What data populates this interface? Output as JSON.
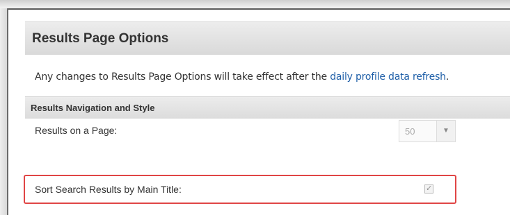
{
  "panel": {
    "title": "Results Page Options",
    "notice_prefix": "Any changes to Results Page Options will take effect after the ",
    "notice_link": "daily profile data refresh",
    "notice_suffix": "."
  },
  "section": {
    "title": "Results Navigation and Style"
  },
  "rows": {
    "results_per_page_label": "Results on a Page:",
    "results_per_page_value": "50",
    "sort_label": "Sort Search Results by Main Title:",
    "sort_checked": true
  },
  "icons": {
    "dropdown": "chevron-down-icon",
    "checkbox_mark": "check-icon"
  },
  "colors": {
    "link": "#1f5fa8",
    "highlight_border": "#e04545",
    "header_bg": "#e3e3e3"
  }
}
